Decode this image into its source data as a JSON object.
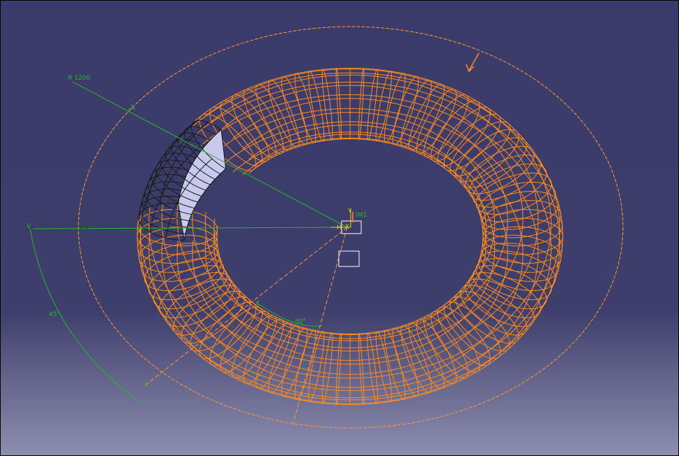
{
  "colors": {
    "background_top": "#3b3b6b",
    "background_bottom": "#8e8eb0",
    "wireframe": "#ff8c1a",
    "selected_fill": "#c9c9ee",
    "selected_stroke": "#1a1a1a",
    "dimension": "#22bb22",
    "axis_label": "#d8d800",
    "white": "#ffffff"
  },
  "annotations": {
    "radius_label": "R 1200",
    "angle_large": "45°",
    "angle_small": "30°",
    "axis_v": "V",
    "axis_h": "H",
    "axis_y": "Y",
    "axis_x": "X",
    "compass_label": "IM1",
    "constraint_marks": "⊕⊕"
  },
  "icons": {
    "manipulator_arrow": "arrow-icon",
    "axis_system": "axis-system-icon",
    "constraint": "constraint-icon"
  }
}
